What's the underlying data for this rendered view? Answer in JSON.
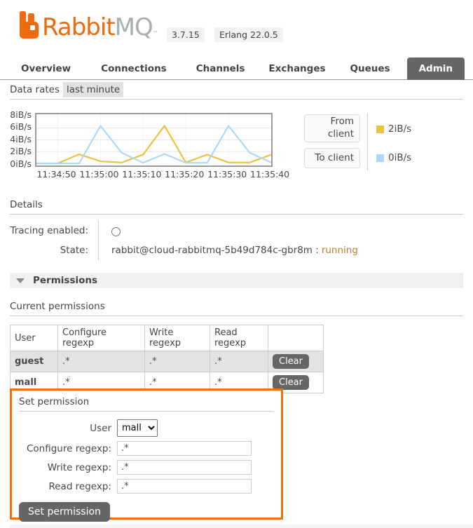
{
  "header": {
    "brand": {
      "rabbit": "Rabbit",
      "mq": "MQ",
      "tm": "™"
    },
    "badges": {
      "version": "3.7.15",
      "erlang": "Erlang 22.0.5"
    }
  },
  "tabs": [
    {
      "label": "Overview"
    },
    {
      "label": "Connections"
    },
    {
      "label": "Channels"
    },
    {
      "label": "Exchanges"
    },
    {
      "label": "Queues"
    },
    {
      "label": "Admin",
      "active": true
    }
  ],
  "data_rates": {
    "title": "Data rates",
    "range_label": "last minute"
  },
  "chart_data": {
    "type": "line",
    "title": "Data rates (last minute)",
    "x": [
      "11:34:45",
      "11:34:50",
      "11:34:55",
      "11:35:00",
      "11:35:05",
      "11:35:10",
      "11:35:15",
      "11:35:20",
      "11:35:25",
      "11:35:30",
      "11:35:35",
      "11:35:40"
    ],
    "x_tick_labels": [
      "11:34:50",
      "11:35:00",
      "11:35:10",
      "11:35:20",
      "11:35:30",
      "11:35:40"
    ],
    "y_tick_labels": [
      "8iB/s",
      "6iB/s",
      "4iB/s",
      "2iB/s",
      "0iB/s"
    ],
    "ylim": [
      0,
      8
    ],
    "grid": true,
    "legend_position": "right",
    "series": [
      {
        "name": "From client",
        "color": "#edc240",
        "current_rate": "2iB/s",
        "values": [
          0,
          0,
          1.55,
          0.35,
          0.15,
          1.5,
          6.4,
          0.15,
          1.5,
          0.15,
          0.15,
          1.5
        ]
      },
      {
        "name": "To client",
        "color": "#afd8f8",
        "current_rate": "0iB/s",
        "values": [
          0,
          0,
          0,
          6.4,
          1.8,
          0.1,
          1.6,
          0.1,
          0.1,
          6.4,
          1.8,
          0.15
        ]
      }
    ]
  },
  "chart_controls": {
    "from_client_label": "From client",
    "to_client_label": "To client",
    "legend": [
      {
        "label": "2iB/s",
        "color": "#edc240"
      },
      {
        "label": "0iB/s",
        "color": "#afd8f8"
      }
    ]
  },
  "details": {
    "title": "Details",
    "tracing_label": "Tracing enabled:",
    "state_label": "State:",
    "state_node": "rabbit@cloud-rabbitmq-5b49d784c-gbr8m",
    "state_separator": ":",
    "state_value": "running",
    "state_color": "#c87e28"
  },
  "permissions_section": {
    "title": "Permissions"
  },
  "current_permissions": {
    "title": "Current permissions",
    "columns": [
      "User",
      "Configure regexp",
      "Write regexp",
      "Read regexp",
      ""
    ],
    "rows": [
      {
        "user": "guest",
        "configure": ".*",
        "write": ".*",
        "read": ".*",
        "action": "Clear"
      },
      {
        "user": "mall",
        "configure": ".*",
        "write": ".*",
        "read": ".*",
        "action": "Clear"
      }
    ]
  },
  "set_permission": {
    "title": "Set permission",
    "user_label": "User",
    "user_value": "mall",
    "fields": [
      {
        "label": "Configure regexp:",
        "value": ".*"
      },
      {
        "label": "Write regexp:",
        "value": ".*"
      },
      {
        "label": "Read regexp:",
        "value": ".*"
      }
    ],
    "submit_label": "Set permission",
    "highlight_color": "#ee720e"
  }
}
